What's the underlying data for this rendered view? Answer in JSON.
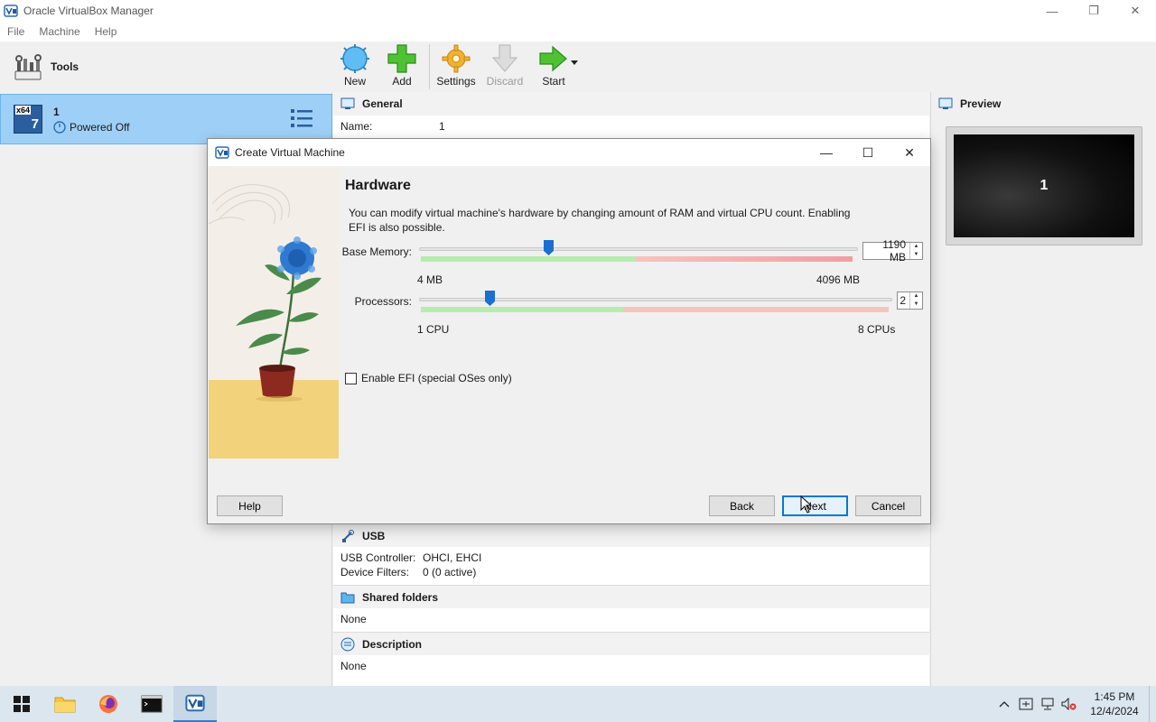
{
  "window": {
    "title": "Oracle VirtualBox Manager",
    "controls": {
      "minimize": "—",
      "restore": "❐",
      "close": "✕"
    }
  },
  "menu": {
    "items": [
      "File",
      "Machine",
      "Help"
    ]
  },
  "leftpane": {
    "tools_label": "Tools",
    "vm": {
      "badge_top": "x64",
      "badge_num": "7",
      "name": "1",
      "state": "Powered Off"
    }
  },
  "toolbar": {
    "new": "New",
    "add": "Add",
    "settings": "Settings",
    "discard": "Discard",
    "start": "Start"
  },
  "details": {
    "general": {
      "title": "General",
      "name_key": "Name:",
      "name_val": "1"
    },
    "usb": {
      "title": "USB",
      "controller_key": "USB Controller:",
      "controller_val": "OHCI, EHCI",
      "filters_key": "Device Filters:",
      "filters_val": "0 (0 active)"
    },
    "shared": {
      "title": "Shared folders",
      "value": "None"
    },
    "description": {
      "title": "Description",
      "value": "None"
    }
  },
  "preview": {
    "title": "Preview",
    "screen_text": "1"
  },
  "dialog": {
    "title": "Create Virtual Machine",
    "controls": {
      "minimize": "—",
      "maximize": "☐",
      "close": "✕"
    },
    "heading": "Hardware",
    "description": "You can modify virtual machine's hardware by changing amount of RAM and virtual CPU count. Enabling EFI is also possible.",
    "memory": {
      "label": "Base Memory:",
      "value": "1190 MB",
      "min_label": "4 MB",
      "max_label": "4096 MB",
      "min": 4,
      "max": 4096,
      "current": 1190
    },
    "processors": {
      "label": "Processors:",
      "value": "2",
      "min_label": "1 CPU",
      "max_label": "8 CPUs",
      "min": 1,
      "max": 8,
      "current": 2
    },
    "efi_label": "Enable EFI (special OSes only)",
    "efi_checked": false,
    "buttons": {
      "help": "Help",
      "back": "Back",
      "next": "Next",
      "cancel": "Cancel"
    }
  },
  "taskbar": {
    "clock_time": "1:45 PM",
    "clock_date": "12/4/2024"
  }
}
